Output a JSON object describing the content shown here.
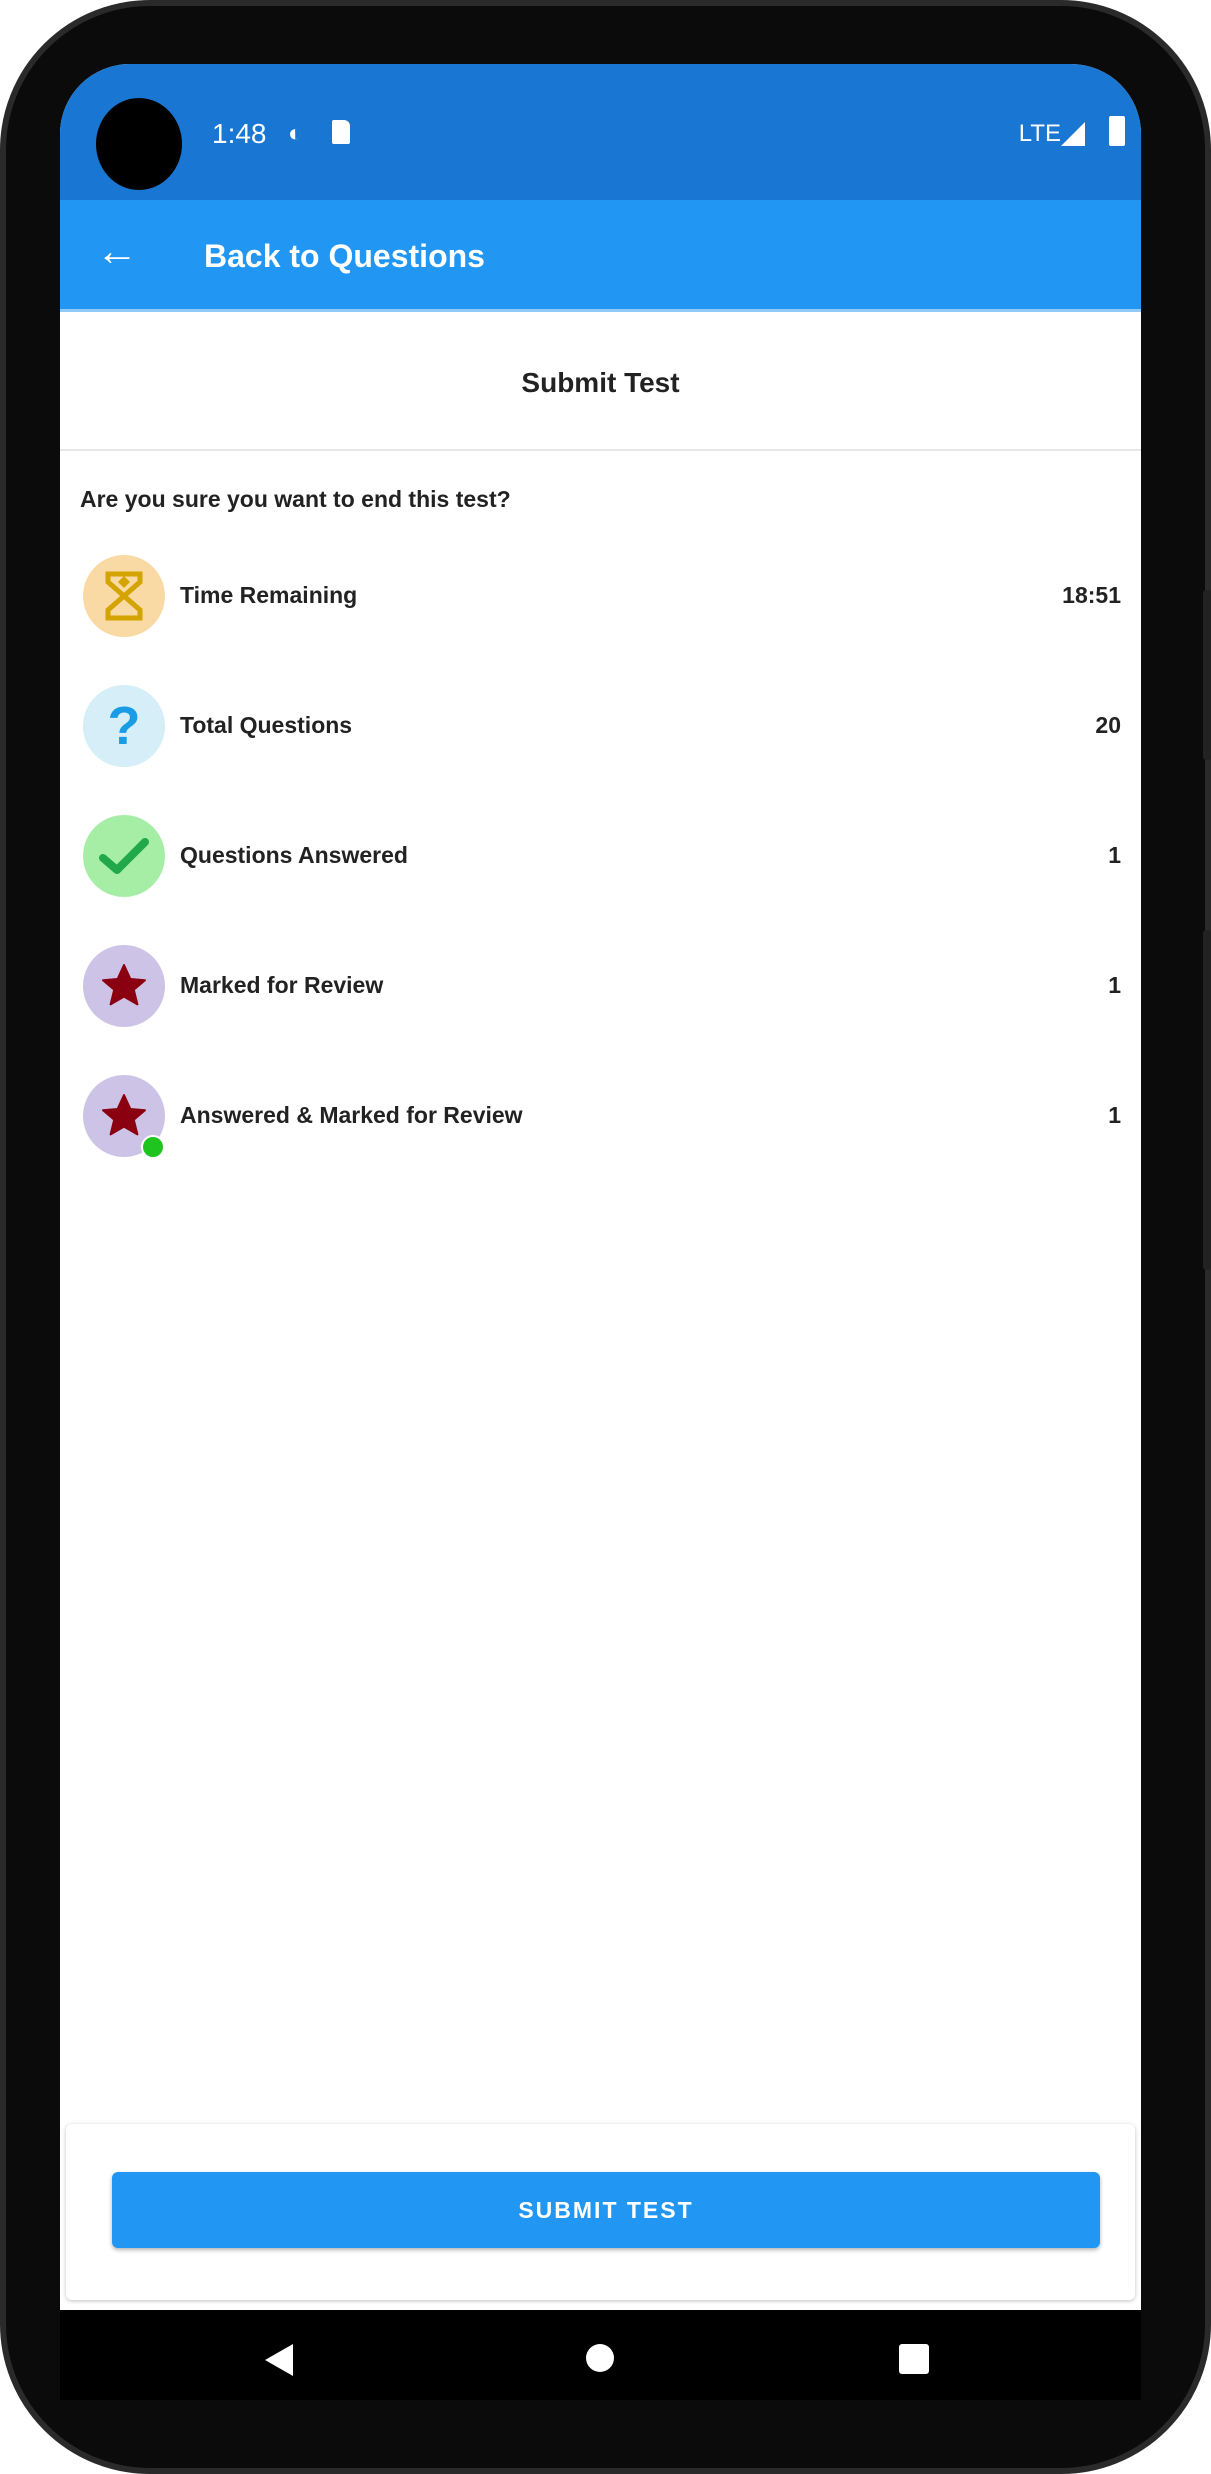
{
  "status_bar": {
    "time": "1:48",
    "network": "LTE"
  },
  "app_bar": {
    "title": "Back to Questions"
  },
  "header": {
    "title": "Submit Test"
  },
  "prompt": "Are you sure you want to end this test?",
  "stats": [
    {
      "label": "Time Remaining",
      "value": "18:51",
      "icon": "hourglass-icon",
      "bg": "#f9d9a4",
      "fg": "#d4a400"
    },
    {
      "label": "Total Questions",
      "value": "20",
      "icon": "question-icon",
      "bg": "#d5eef7",
      "fg": "#1a9be6"
    },
    {
      "label": "Questions Answered",
      "value": "1",
      "icon": "check-icon",
      "bg": "#a6eea6",
      "fg": "#20a84a"
    },
    {
      "label": "Marked for Review",
      "value": "1",
      "icon": "star-icon",
      "bg": "#ccc3e6",
      "fg": "#8b0010"
    },
    {
      "label": "Answered & Marked for Review",
      "value": "1",
      "icon": "star-icon",
      "bg": "#ccc3e6",
      "fg": "#8b0010"
    }
  ],
  "submit_label": "SUBMIT TEST"
}
